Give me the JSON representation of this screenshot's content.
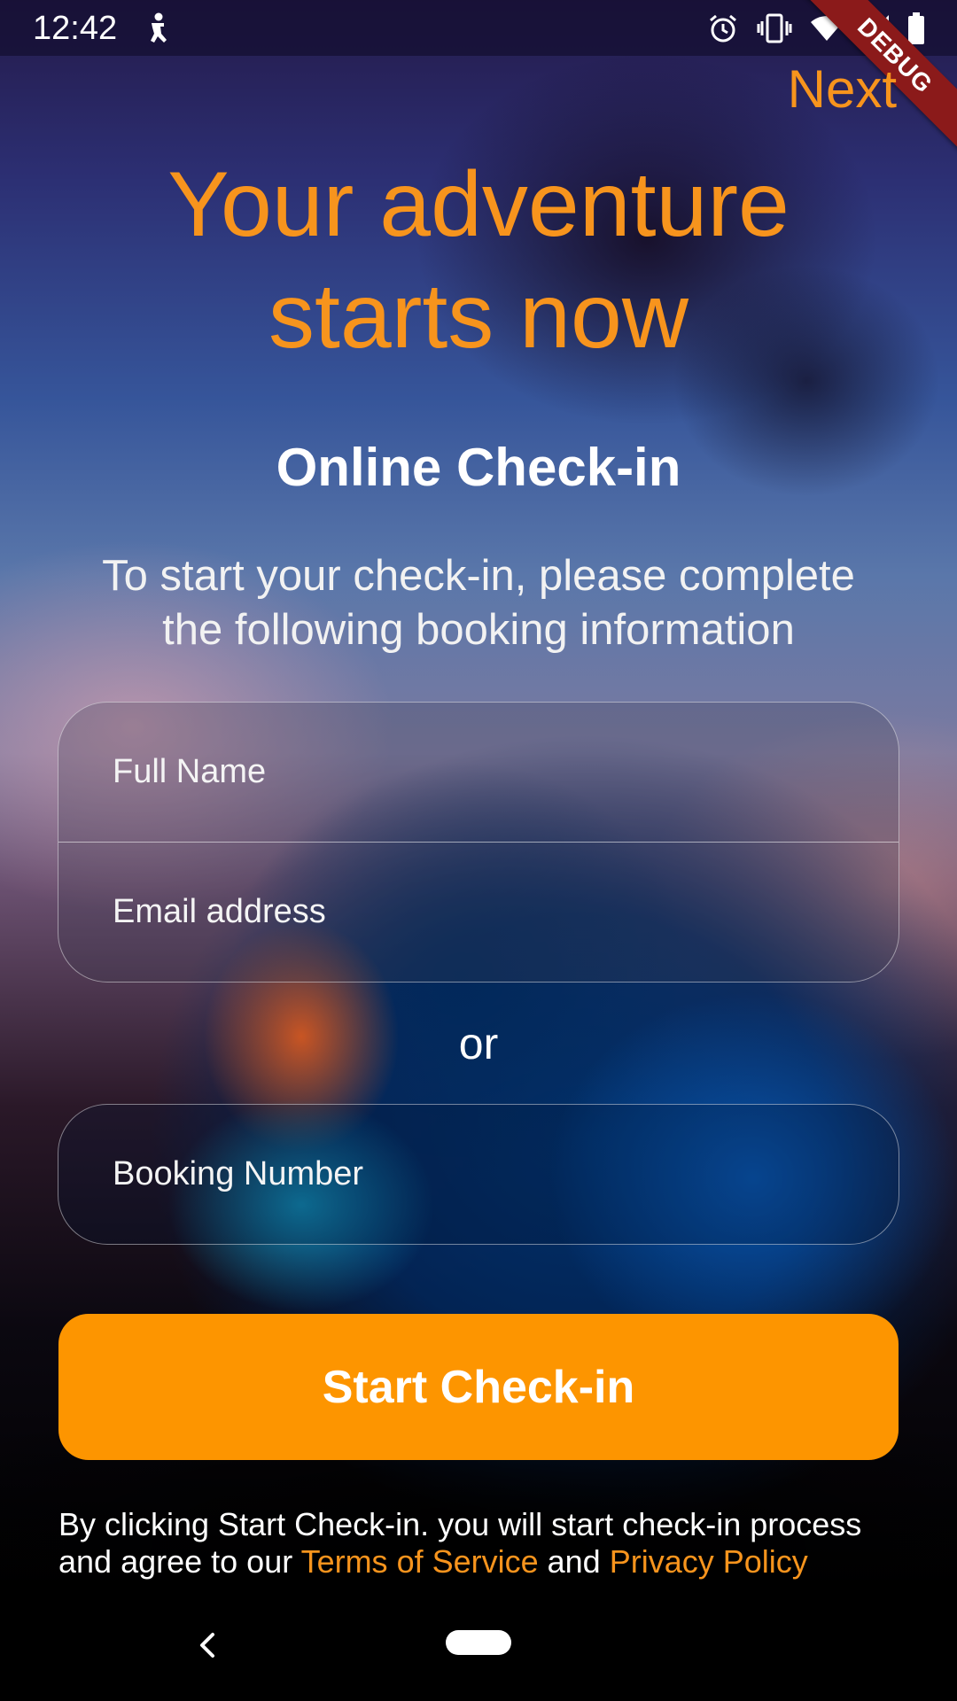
{
  "status_bar": {
    "time": "12:42",
    "left_icon": "accessibility-icon",
    "right_icons": [
      "alarm-icon",
      "vibrate-icon",
      "wifi-icon",
      "signal-icon",
      "battery-icon"
    ]
  },
  "debug_banner": {
    "label": "DEBUG",
    "color": "#8b1a1a"
  },
  "header": {
    "next_label": "Next"
  },
  "hero": {
    "line1": "Your adventure",
    "line2": "starts now"
  },
  "section": {
    "title": "Online Check-in",
    "subtitle_line1": "To start your check-in, please complete",
    "subtitle_line2": "the following booking information"
  },
  "form": {
    "full_name": {
      "placeholder": "Full Name",
      "value": ""
    },
    "email": {
      "placeholder": "Email address",
      "value": ""
    },
    "or_label": "or",
    "booking_number": {
      "placeholder": "Booking Number",
      "value": ""
    }
  },
  "cta": {
    "start_label": "Start Check-in"
  },
  "legal": {
    "line1": "By clicking Start Check-in. you will start check-in process",
    "line2_prefix": "and agree to our ",
    "terms_label": "Terms of Service",
    "and_label": " and ",
    "privacy_label": "Privacy Policy"
  },
  "nav": {
    "back_icon": "back-chevron-icon",
    "home_icon": "home-pill-icon"
  },
  "colors": {
    "accent": "#f7941d",
    "button": "#fd9500",
    "text": "#ffffff"
  }
}
